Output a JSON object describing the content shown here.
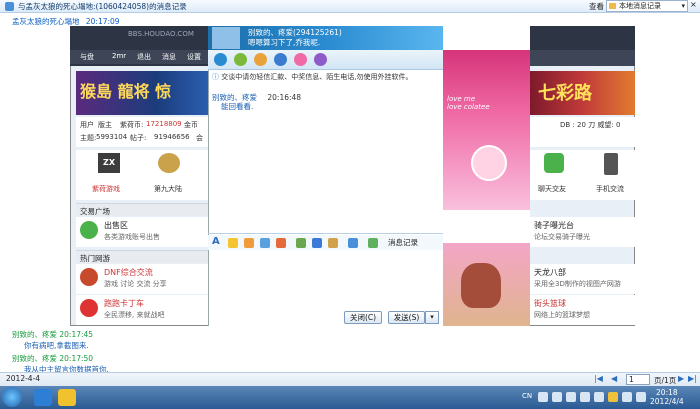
{
  "window": {
    "title": "与孟灰太狼的死心塌地:(1060424058)的消息记录",
    "view_label": "查看",
    "local_history_label": "本地消息记录",
    "close": "×"
  },
  "first_message": {
    "sender": "孟灰太狼的死心塌地",
    "time": "20:17:09"
  },
  "screenshot": {
    "forum": {
      "url": "BBS.HOUDAO.COM",
      "nav": [
        "与盘",
        "2mr",
        "退出",
        "消息",
        "设置"
      ],
      "banner": "猴島 龍将 惊",
      "user_line1": {
        "a": "用户",
        "b": "版主",
        "c": "紫荷币:",
        "d": "17218809",
        "e": "金币"
      },
      "user_line2": {
        "a": "主题:",
        "b": "5993104",
        "c": "帖子:",
        "d": "91946656",
        "e": "会"
      },
      "icons": [
        {
          "label": "ZX",
          "caption": "紫荷游戏"
        },
        {
          "label": "",
          "caption": "第九大陆"
        }
      ],
      "section1": "交易广场",
      "item1": {
        "title": "出售区",
        "desc": "各类游戏账号出售"
      },
      "section2": "热门网游",
      "item2": {
        "title": "DNF综合交流",
        "desc": "游戏 讨论 交流 分享"
      },
      "item3": {
        "title": "跑跑卡丁车",
        "desc": "全民漂移, 来就战吧"
      }
    },
    "chat": {
      "contact_name": "别致的、疼爱(294125261)",
      "signature": "嗯嗯算习下了,乔我呢.",
      "notice": "交谈中请勿轻信汇款、中奖信息、陌生电话,勿使用外挂软件。",
      "message_sender": "别致的、疼爱",
      "message_time": "20:16:48",
      "message_text": "能回看看.",
      "show_text": "love me\nlove colatee",
      "message_record_label": "消息记录",
      "close_button": "关闭(C)",
      "send_button": "发送(S)",
      "send_arrow": "▾"
    },
    "right": {
      "banner": "七彩路",
      "info": "DB : 20 刀    威望: 0",
      "icons": [
        {
          "caption": "聊天交友"
        },
        {
          "caption": "手机交流"
        }
      ],
      "item1": {
        "title": "骑子曝光台",
        "desc": "论坛交易骑子曝光"
      },
      "item2": {
        "title": "天龙八部",
        "desc": "采用全3D制作的视图产网游"
      },
      "item3": {
        "title": "街头篮球",
        "desc": "网络上的篮球梦想"
      }
    }
  },
  "history": [
    {
      "sender": "别致的、疼爱",
      "time": "20:17:45",
      "text": "你有病吧,拿截图来."
    },
    {
      "sender": "别致的、疼爱",
      "time": "20:17:50",
      "text": "我从中主留言你数据首你."
    }
  ],
  "bottom": {
    "date": "2012-4-4",
    "page_value": "1",
    "page_label": "页/1页",
    "first": "|◀",
    "prev": "◀",
    "next": "▶",
    "last": "▶|"
  },
  "taskbar": {
    "lang": "CN",
    "time": "20:18",
    "date": "2012/4/4"
  }
}
